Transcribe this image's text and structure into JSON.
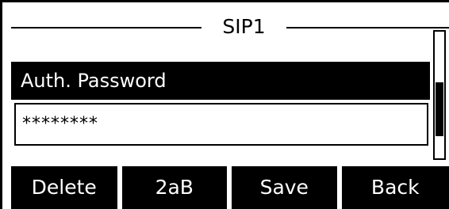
{
  "screen": {
    "title": "SIP1"
  },
  "field": {
    "label": "Auth. Password",
    "value": "********"
  },
  "scrollbar": {
    "position": 0.45
  },
  "softkeys": [
    {
      "label": "Delete"
    },
    {
      "label": "2aB"
    },
    {
      "label": "Save"
    },
    {
      "label": "Back"
    }
  ]
}
